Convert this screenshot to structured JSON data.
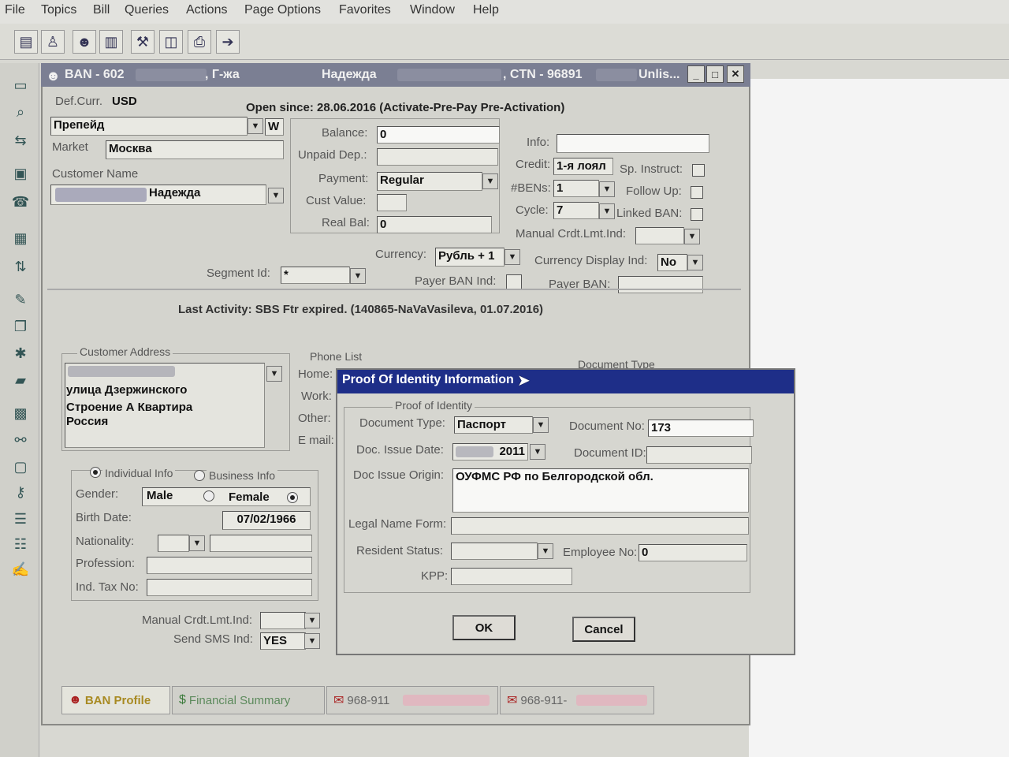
{
  "menu": [
    "File",
    "Topics",
    "Bill",
    "Queries",
    "Actions",
    "Page Options",
    "Favorites",
    "Window",
    "Help"
  ],
  "window": {
    "title_ban": "BAN - 602",
    "title_gzha": ", Г-жа",
    "title_name": "Надежда",
    "title_ctn": ", CTN - 96891",
    "title_status": "Unlis..."
  },
  "header": {
    "def_curr_label": "Def.Curr.",
    "def_curr_value": "USD",
    "open_since": "Open since: 28.06.2016 (Activate-Pre-Pay Pre-Activation)",
    "account_type": "Препейд",
    "account_type_flag": "W",
    "market_label": "Market",
    "market_value": "Москва",
    "customer_name_label": "Customer Name",
    "customer_name_value": "Надежда"
  },
  "balance": {
    "balance_label": "Balance:",
    "balance_value": "0",
    "unpaid_dep_label": "Unpaid Dep.:",
    "payment_label": "Payment:",
    "payment_value": "Regular",
    "cust_value_label": "Cust Value:",
    "real_bal_label": "Real Bal:",
    "real_bal_value": "0"
  },
  "info": {
    "info_label": "Info:",
    "credit_label": "Credit:",
    "credit_value": "1-я лоял",
    "bens_label": "#BENs:",
    "bens_value": "1",
    "cycle_label": "Cycle:",
    "cycle_value": "7",
    "manual_crdt_label": "Manual Crdt.Lmt.Ind:",
    "sp_instruct_label": "Sp. Instruct:",
    "follow_up_label": "Follow Up:",
    "linked_ban_label": "Linked BAN:"
  },
  "currency": {
    "currency_label": "Currency:",
    "currency_value": "Рубль + 1",
    "display_ind_label": "Currency Display Ind:",
    "display_ind_value": "No",
    "segment_label": "Segment Id:",
    "segment_value": "*",
    "payer_ban_ind_label": "Payer BAN Ind:",
    "payer_ban_label": "Payer BAN:"
  },
  "last_activity": "Last Activity: SBS Ftr expired. (140865-NaVaVasileva, 01.07.2016)",
  "address": {
    "group_label": "Customer Address",
    "line1": "улица Дзержинского",
    "line2": "Строение А Квартира",
    "line3": "Россия"
  },
  "phone": {
    "group_label": "Phone List",
    "home_label": "Home:",
    "work_label": "Work:",
    "other_label": "Other:",
    "email_label": "E mail:",
    "doc_type_label": "Document Type"
  },
  "individual": {
    "individual_label": "Individual Info",
    "business_label": "Business Info",
    "gender_label": "Gender:",
    "male_label": "Male",
    "female_label": "Female",
    "birth_label": "Birth Date:",
    "birth_value": "07/02/1966",
    "nationality_label": "Nationality:",
    "profession_label": "Profession:",
    "tax_label": "Ind. Tax No:",
    "manual_crdt_label": "Manual Crdt.Lmt.Ind:",
    "sms_label": "Send SMS Ind:",
    "sms_value": "YES"
  },
  "dialog": {
    "title": "Proof Of Identity Information",
    "group_label": "Proof of Identity",
    "doc_type_label": "Document Type:",
    "doc_type_value": "Паспорт",
    "doc_no_label": "Document No:",
    "doc_no_value": "173",
    "issue_date_label": "Doc. Issue Date:",
    "issue_date_value": "2011",
    "doc_id_label": "Document ID:",
    "origin_label": "Doc Issue Origin:",
    "origin_value": "ОУФМС РФ по Белгородской обл.",
    "legal_form_label": "Legal Name Form:",
    "resident_label": "Resident Status:",
    "employee_label": "Employee No:",
    "employee_value": "0",
    "kpp_label": "KPP:",
    "ok_label": "OK",
    "cancel_label": "Cancel"
  },
  "tabs": [
    "BAN Profile",
    "Financial Summary",
    "968-911",
    "968-911-"
  ]
}
